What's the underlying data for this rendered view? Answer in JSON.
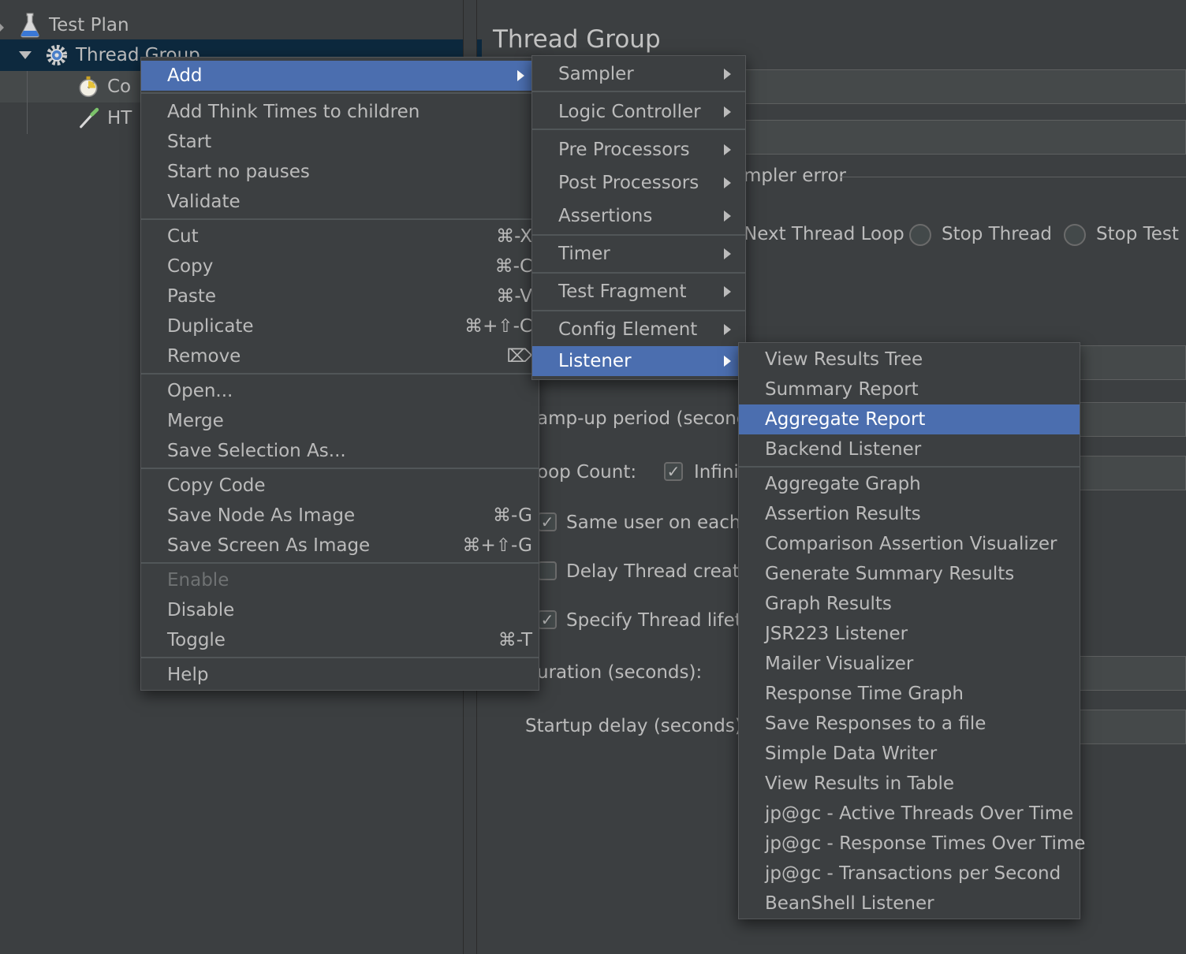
{
  "tree": {
    "items": [
      {
        "label": "Test Plan",
        "icon": "flask-icon"
      },
      {
        "label": "Thread Group",
        "icon": "gear-icon"
      },
      {
        "label": "Co",
        "icon": "stopwatch-icon"
      },
      {
        "label": "HT",
        "icon": "pipette-icon"
      }
    ]
  },
  "editor": {
    "title": "Thread Group",
    "sampler_error_label": "mpler error",
    "radio_next_thread_loop": "Next Thread Loop",
    "radio_stop_thread": "Stop Thread",
    "radio_stop_test": "Stop Test",
    "ramp_up_label": "amp-up period (seconds",
    "loop_count_label": "oop Count:",
    "infinite_label": "Infinit",
    "same_user_label": "Same user on each it",
    "delay_thread_label": "Delay Thread creatio",
    "specify_lifetime_label": "Specify Thread lifeti",
    "duration_label": "uration (seconds):",
    "startup_delay_label": "Startup delay (seconds):"
  },
  "context_menu": {
    "add": "Add",
    "add_think_times": "Add Think Times to children",
    "start": "Start",
    "start_no_pauses": "Start no pauses",
    "validate": "Validate",
    "cut": "Cut",
    "cut_key": "⌘-X",
    "copy": "Copy",
    "copy_key": "⌘-C",
    "paste": "Paste",
    "paste_key": "⌘-V",
    "duplicate": "Duplicate",
    "duplicate_key": "⌘+⇧-C",
    "remove": "Remove",
    "remove_key": "⌦",
    "open": "Open...",
    "merge": "Merge",
    "save_selection_as": "Save Selection As...",
    "copy_code": "Copy Code",
    "save_node_as_image": "Save Node As Image",
    "save_node_key": "⌘-G",
    "save_screen_as_image": "Save Screen As Image",
    "save_screen_key": "⌘+⇧-G",
    "enable": "Enable",
    "disable": "Disable",
    "toggle": "Toggle",
    "toggle_key": "⌘-T",
    "help": "Help"
  },
  "add_submenu": {
    "sampler": "Sampler",
    "logic_controller": "Logic Controller",
    "pre_processors": "Pre Processors",
    "post_processors": "Post Processors",
    "assertions": "Assertions",
    "timer": "Timer",
    "test_fragment": "Test Fragment",
    "config_element": "Config Element",
    "listener": "Listener"
  },
  "listener_submenu": {
    "items_top": [
      "View Results Tree",
      "Summary Report",
      "Aggregate Report",
      "Backend Listener"
    ],
    "items_bottom": [
      "Aggregate Graph",
      "Assertion Results",
      "Comparison Assertion Visualizer",
      "Generate Summary Results",
      "Graph Results",
      "JSR223 Listener",
      "Mailer Visualizer",
      "Response Time Graph",
      "Save Responses to a file",
      "Simple Data Writer",
      "View Results in Table",
      "jp@gc - Active Threads Over Time",
      "jp@gc - Response Times Over Time",
      "jp@gc - Transactions per Second",
      "BeanShell Listener"
    ],
    "highlighted": "Aggregate Report"
  },
  "colors": {
    "background": "#3c3f41",
    "menu_highlight": "#4b6eaf",
    "tree_selection": "#0d293e"
  }
}
